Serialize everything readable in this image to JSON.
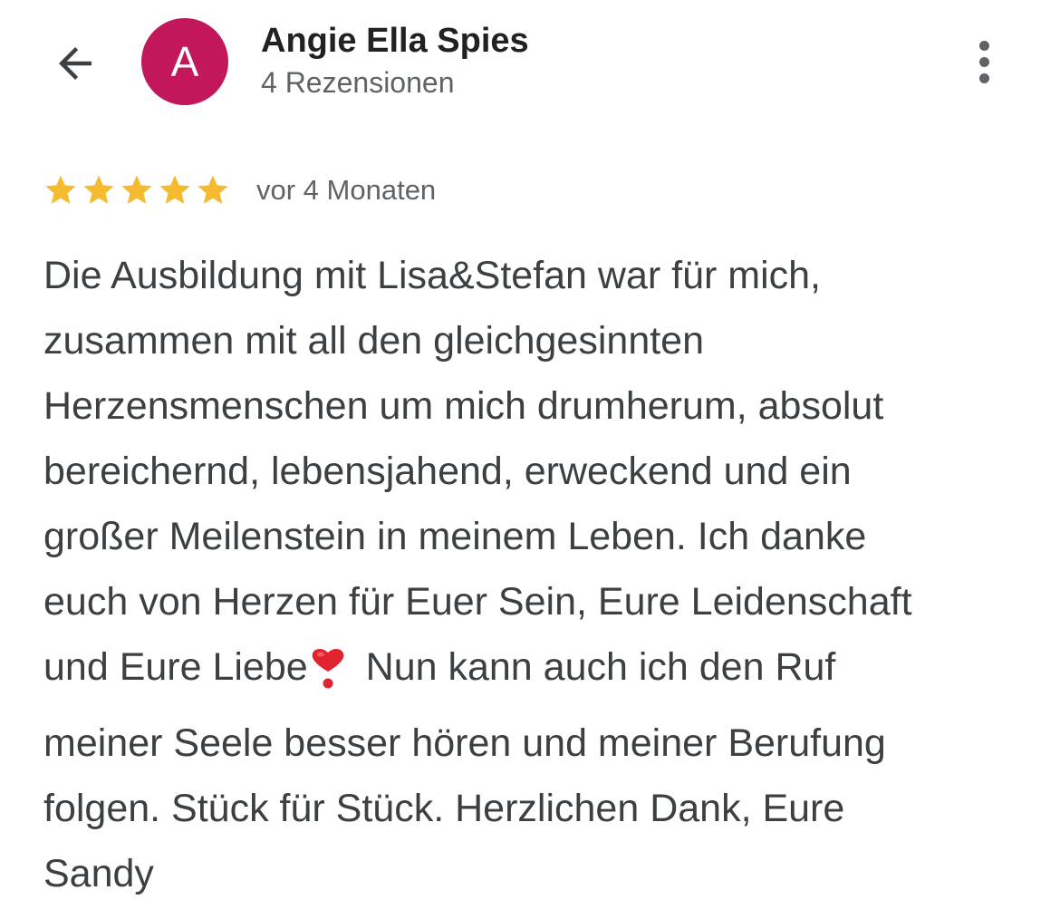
{
  "header": {
    "avatar_letter": "A",
    "avatar_color": "#c2185b",
    "name": "Angie Ella Spies",
    "subtitle": "4 Rezensionen",
    "back_icon": "arrow-back-icon",
    "menu_icon": "more-vert-icon"
  },
  "review": {
    "rating": 5,
    "rating_max": 5,
    "star_color": "#f5bb30",
    "date": "vor 4 Monaten",
    "text_before_emoji": "Die Ausbildung mit Lisa&Stefan war für mich,\nzusammen mit all den gleichgesinnten\nHerzensmenschen um mich drumherum, absolut\nbereichernd, lebensjahend, erweckend und ein\ngroßer Meilenstein in meinem Leben. Ich danke\neuch von Herzen für Euer Sein, Eure Leidenschaft\nund Eure Liebe",
    "emoji": "heavy-heart-exclamation-icon",
    "text_after_emoji": " Nun kann auch ich den Ruf\nmeiner Seele besser hören und meiner Berufung\nfolgen. Stück für Stück. Herzlichen Dank, Eure\nSandy"
  }
}
